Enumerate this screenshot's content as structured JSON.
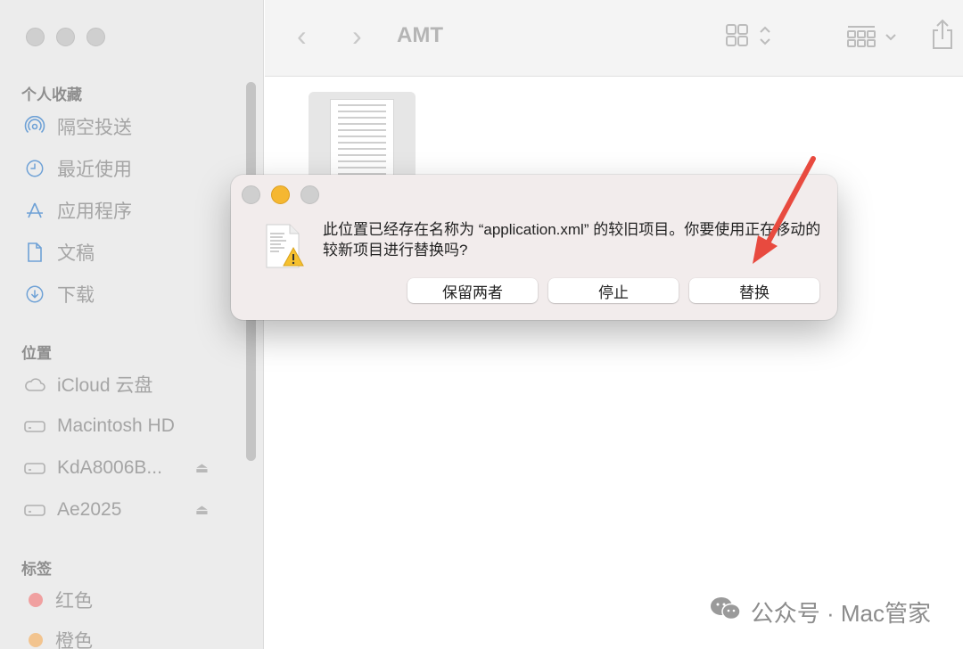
{
  "sidebar": {
    "favorites_title": "个人收藏",
    "favorites": [
      {
        "label": "隔空投送",
        "icon": "airdrop-icon"
      },
      {
        "label": "最近使用",
        "icon": "clock-icon"
      },
      {
        "label": "应用程序",
        "icon": "applications-icon"
      },
      {
        "label": "文稿",
        "icon": "document-icon"
      },
      {
        "label": "下载",
        "icon": "download-icon"
      }
    ],
    "locations_title": "位置",
    "locations": [
      {
        "label": "iCloud 云盘",
        "icon": "cloud-icon"
      },
      {
        "label": "Macintosh HD",
        "icon": "disk-icon"
      },
      {
        "label": "KdA8006B...",
        "icon": "disk-icon",
        "eject": "⏏"
      },
      {
        "label": "Ae2025",
        "icon": "disk-icon",
        "eject": "⏏"
      }
    ],
    "tags_title": "标签",
    "tags": [
      {
        "label": "红色",
        "color": "#f0a0a0"
      },
      {
        "label": "橙色",
        "color": "#f2c48f"
      }
    ]
  },
  "toolbar": {
    "back": "‹",
    "forward": "›",
    "title": "AMT"
  },
  "dialog": {
    "message": "此位置已经存在名称为 “application.xml” 的较旧项目。你要使用正在移动的较新项目进行替换吗?",
    "buttons": {
      "keep_both": "保留两者",
      "stop": "停止",
      "replace": "替换"
    },
    "traffic_colors": [
      "#cfcfcf",
      "#f5b731",
      "#cfcfcf"
    ]
  },
  "watermark": {
    "text": "公众号 · Mac管家"
  },
  "colors": {
    "annotation_arrow": "#e84a3f",
    "sidebar_icon": "#6ea1d6"
  }
}
